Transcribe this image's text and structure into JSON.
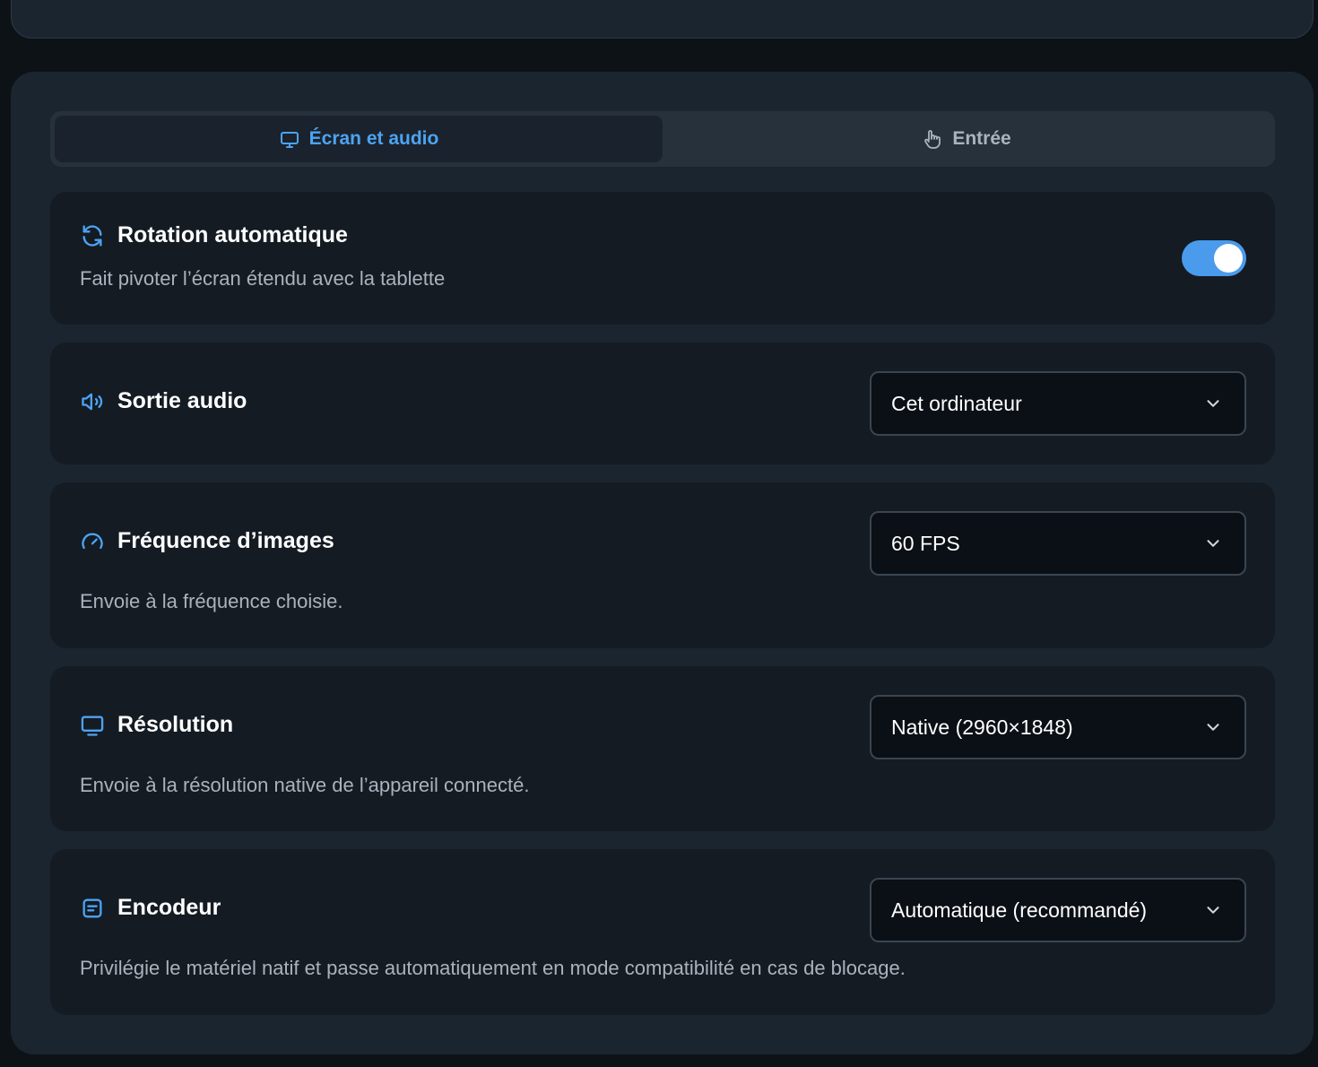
{
  "tabs": [
    {
      "label": "Écran et audio",
      "icon": "monitor-icon",
      "active": true
    },
    {
      "label": "Entrée",
      "icon": "hand-icon",
      "active": false
    }
  ],
  "rotation": {
    "title": "Rotation automatique",
    "description": "Fait pivoter l’écran étendu avec la tablette",
    "enabled": true,
    "icon": "refresh-icon"
  },
  "audio": {
    "title": "Sortie audio",
    "selected": "Cet ordinateur",
    "icon": "speaker-icon"
  },
  "framerate": {
    "title": "Fréquence d’images",
    "selected": "60 FPS",
    "description": "Envoie à la fréquence choisie.",
    "icon": "gauge-icon"
  },
  "resolution": {
    "title": "Résolution",
    "selected": "Native (2960×1848)",
    "description": "Envoie à la résolution native de l’appareil connecté.",
    "icon": "monitor-icon"
  },
  "encoder": {
    "title": "Encodeur",
    "selected": "Automatique (recommandé)",
    "description": "Privilégie le matériel natif et passe automatiquement en mode compatibilité en cas de blocage.",
    "icon": "encoder-icon"
  },
  "colors": {
    "accent": "#4a9bec",
    "background": "#0d1217",
    "panel": "#1b2530",
    "card": "#141b23"
  }
}
